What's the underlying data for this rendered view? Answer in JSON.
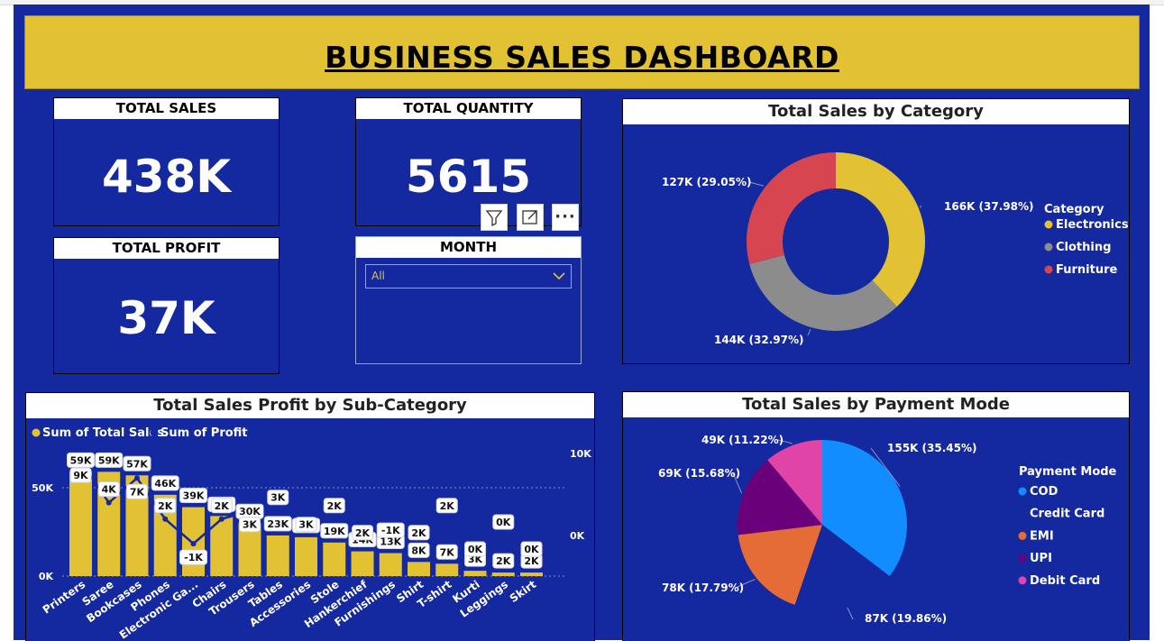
{
  "dashboard_title": "BUSINESS SALES DASHBOARD",
  "colors": {
    "background": "#1428a0",
    "title_bar": "#e2c232",
    "electronics": "#e2c232",
    "clothing": "#8c8c8c",
    "furniture": "#d64550",
    "cod": "#118dff",
    "credit_card": "#1428a0",
    "emi": "#e66c37",
    "upi": "#6b007b",
    "debit_card": "#e044a7",
    "profit_line": "#1428a0"
  },
  "kpis": {
    "total_sales": {
      "label": "TOTAL SALES",
      "value": "438K"
    },
    "total_quantity": {
      "label": "TOTAL QUANTITY",
      "value": "5615"
    },
    "total_profit": {
      "label": "TOTAL PROFIT",
      "value": "37K"
    }
  },
  "visual_toolbar": {
    "filter_icon": "filter-icon",
    "focus_icon": "focus-mode-icon",
    "more_icon": "more-options-icon",
    "more_label": "···"
  },
  "month_slicer": {
    "label": "MONTH",
    "selected": "All",
    "icon": "chevron-down-icon"
  },
  "charts": {
    "category": {
      "title": "Total Sales by Category",
      "legend_title": "Category"
    },
    "subcategory": {
      "title": "Total Sales Profit by Sub-Category"
    },
    "payment": {
      "title": "Total Sales by Payment Mode",
      "legend_title": "Payment Mode"
    }
  },
  "chart_data": [
    {
      "type": "pie",
      "subtype": "donut",
      "title": "Total Sales by Category",
      "legend_title": "Category",
      "legend_position": "right",
      "categories": [
        "Electronics",
        "Clothing",
        "Furniture"
      ],
      "values": [
        166,
        144,
        127
      ],
      "percents": [
        37.98,
        32.97,
        29.05
      ],
      "labels": [
        "166K (37.98%)",
        "144K (32.97%)",
        "127K (29.05%)"
      ],
      "colors": [
        "#e2c232",
        "#8c8c8c",
        "#d64550"
      ]
    },
    {
      "type": "bar",
      "subtype": "combo-bar-line",
      "title": "Total Sales Profit by Sub-Category",
      "legend_position": "top-left",
      "categories": [
        "Printers",
        "Saree",
        "Bookcases",
        "Phones",
        "Electronic Ga...",
        "Chairs",
        "Trousers",
        "Tables",
        "Accessories",
        "Stole",
        "Hankerchief",
        "Furnishings",
        "Shirt",
        "T-shirt",
        "Kurti",
        "Leggings",
        "Skirt"
      ],
      "series": [
        {
          "name": "Sum of Total Sales",
          "axis": "left",
          "values": [
            59,
            59,
            57,
            46,
            39,
            34,
            30,
            23,
            22,
            19,
            14,
            13,
            8,
            7,
            3,
            2,
            2
          ],
          "labels": [
            "59K",
            "59K",
            "57K",
            "46K",
            "39K",
            "34K",
            "30K",
            "23K",
            "22K",
            "19K",
            "14K",
            "13K",
            "8K",
            "7K",
            "3K",
            "2K",
            "2K"
          ]
        },
        {
          "name": "Sum of Profit",
          "axis": "right",
          "values": [
            9,
            4,
            7,
            2,
            -1,
            2,
            3,
            3,
            3,
            2,
            2,
            -1,
            2,
            2,
            0,
            0,
            0
          ],
          "labels": [
            "9K",
            "4K",
            "7K",
            "2K",
            "-1K",
            "2K",
            "3K",
            "3K",
            "3K",
            "2K",
            "2K",
            "-1K",
            "2K",
            "2K",
            "0K",
            "0K",
            "0K"
          ]
        }
      ],
      "ylim_left": [
        0,
        50
      ],
      "left_ticks": [
        "0K",
        "50K"
      ],
      "right_ticks": [
        "0K",
        "10K"
      ],
      "grid": true
    },
    {
      "type": "pie",
      "title": "Total Sales by Payment Mode",
      "legend_title": "Payment Mode",
      "legend_position": "right",
      "categories": [
        "COD",
        "Credit Card",
        "EMI",
        "UPI",
        "Debit Card"
      ],
      "values": [
        155,
        87,
        78,
        69,
        49
      ],
      "percents": [
        35.45,
        19.86,
        17.79,
        15.68,
        11.22
      ],
      "labels": [
        "155K (35.45%)",
        "87K (19.86%)",
        "78K (17.79%)",
        "69K (15.68%)",
        "49K (11.22%)"
      ],
      "colors": [
        "#118dff",
        "#1428a0",
        "#e66c37",
        "#6b007b",
        "#e044a7"
      ]
    }
  ]
}
